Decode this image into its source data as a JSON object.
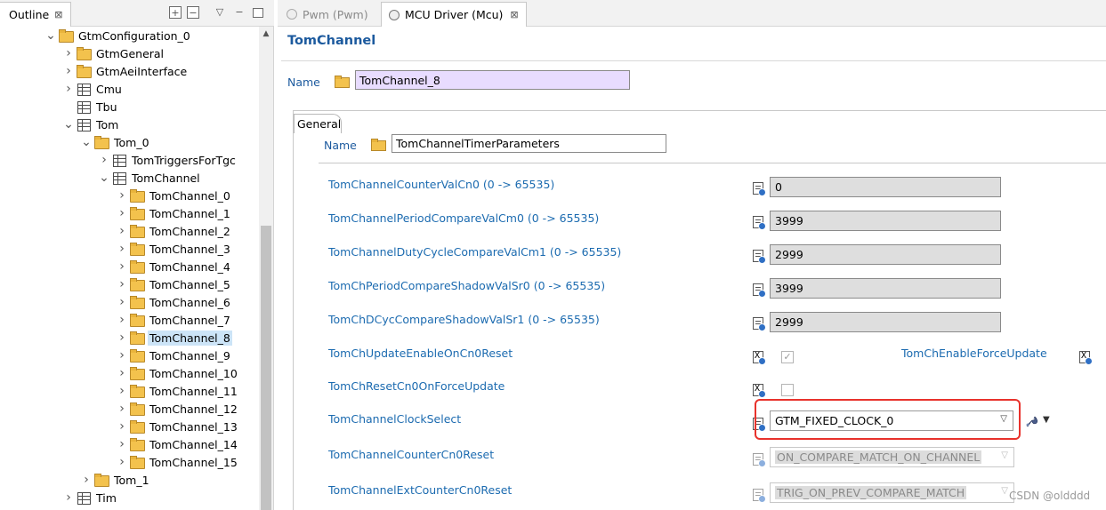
{
  "outline": {
    "tab_label": "Outline",
    "close": "⊠",
    "tree": [
      {
        "label": "GtmConfiguration_0",
        "icon": "folder-icon",
        "expanded": true
      },
      {
        "label": "GtmGeneral",
        "icon": "folder-icon"
      },
      {
        "label": "GtmAeiInterface",
        "icon": "folder-icon"
      },
      {
        "label": "Cmu",
        "icon": "table-icon"
      },
      {
        "label": "Tbu",
        "icon": "table-icon"
      },
      {
        "label": "Tom",
        "icon": "table-icon",
        "expanded": true
      },
      {
        "label": "Tom_0",
        "icon": "folder-icon",
        "expanded": true
      },
      {
        "label": "TomTriggersForTgc",
        "icon": "table-icon"
      },
      {
        "label": "TomChannel",
        "icon": "table-icon",
        "expanded": true
      },
      {
        "label": "TomChannel_0",
        "icon": "folder-icon"
      },
      {
        "label": "TomChannel_1",
        "icon": "folder-icon"
      },
      {
        "label": "TomChannel_2",
        "icon": "folder-icon"
      },
      {
        "label": "TomChannel_3",
        "icon": "folder-icon"
      },
      {
        "label": "TomChannel_4",
        "icon": "folder-icon"
      },
      {
        "label": "TomChannel_5",
        "icon": "folder-icon"
      },
      {
        "label": "TomChannel_6",
        "icon": "folder-icon"
      },
      {
        "label": "TomChannel_7",
        "icon": "folder-icon"
      },
      {
        "label": "TomChannel_8",
        "icon": "folder-icon",
        "selected": true
      },
      {
        "label": "TomChannel_9",
        "icon": "folder-icon"
      },
      {
        "label": "TomChannel_10",
        "icon": "folder-icon"
      },
      {
        "label": "TomChannel_11",
        "icon": "folder-icon"
      },
      {
        "label": "TomChannel_12",
        "icon": "folder-icon"
      },
      {
        "label": "TomChannel_13",
        "icon": "folder-icon"
      },
      {
        "label": "TomChannel_14",
        "icon": "folder-icon"
      },
      {
        "label": "TomChannel_15",
        "icon": "folder-icon"
      },
      {
        "label": "Tom_1",
        "icon": "folder-icon"
      },
      {
        "label": "Tim",
        "icon": "table-icon"
      }
    ]
  },
  "editor": {
    "tabs": [
      {
        "label": "Pwm (Pwm)",
        "active": false
      },
      {
        "label": "MCU Driver (Mcu)",
        "active": true,
        "close": "⊠"
      }
    ],
    "page_title": "TomChannel",
    "name_label": "Name",
    "name_value": "TomChannel_8",
    "group_tab": "General",
    "sub_name_label": "Name",
    "sub_name_value": "TomChannelTimerParameters",
    "params": {
      "counter_val_cn0": {
        "label": "TomChannelCounterValCn0 (0 -> 65535)",
        "value": "0"
      },
      "period_compare_cm0": {
        "label": "TomChannelPeriodCompareValCm0 (0 -> 65535)",
        "value": "3999"
      },
      "duty_cycle_cm1": {
        "label": "TomChannelDutyCycleCompareValCm1 (0 -> 65535)",
        "value": "2999"
      },
      "period_shadow_sr0": {
        "label": "TomChPeriodCompareShadowValSr0 (0 -> 65535)",
        "value": "3999"
      },
      "dcyc_shadow_sr1": {
        "label": "TomChDCycCompareShadowValSr1 (0 -> 65535)",
        "value": "2999"
      },
      "update_enable": {
        "label": "TomChUpdateEnableOnCn0Reset",
        "checked": true
      },
      "force_update": {
        "label": "TomChEnableForceUpdate"
      },
      "reset_cn0": {
        "label": "TomChResetCn0OnForceUpdate",
        "checked": false
      },
      "clock_select": {
        "label": "TomChannelClockSelect",
        "value": "GTM_FIXED_CLOCK_0"
      },
      "counter_cn0_reset": {
        "label": "TomChannelCounterCn0Reset",
        "value": "ON_COMPARE_MATCH_ON_CHANNEL"
      },
      "ext_counter_cn0_reset": {
        "label": "TomChannelExtCounterCn0Reset",
        "value": "TRIG_ON_PREV_COMPARE_MATCH"
      }
    },
    "highlight_color": "#e8322c",
    "link_color": "#1c6bb0"
  },
  "watermark": "CSDN @oldddd"
}
